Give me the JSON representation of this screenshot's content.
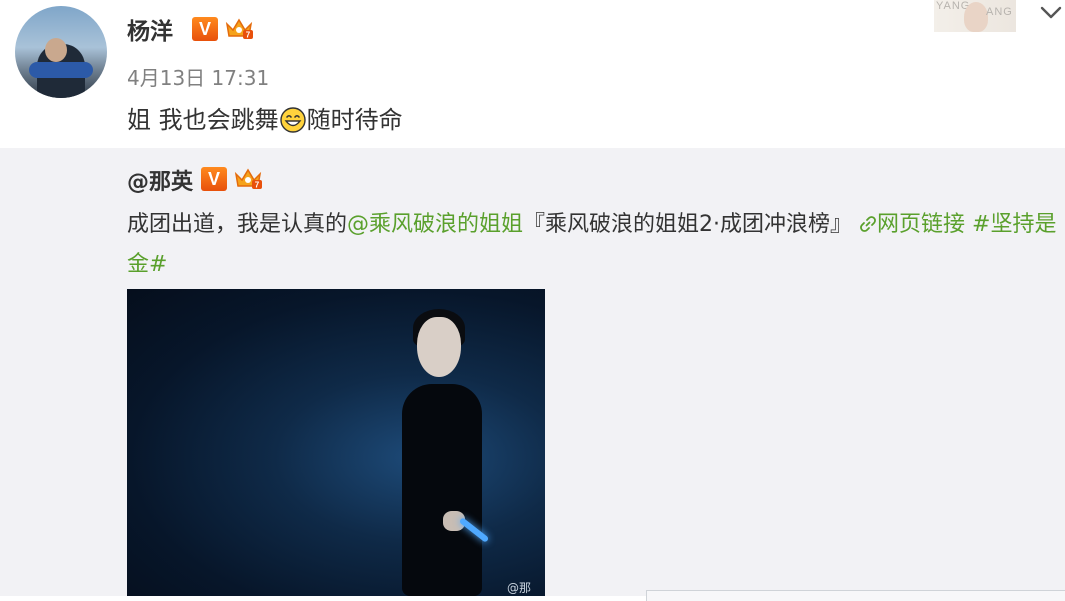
{
  "post": {
    "author": "杨洋",
    "timestamp": "4月13日 17:31",
    "text_before_emoji": "姐 我也会跳舞",
    "emoji_icon": "grinning-face",
    "text_after_emoji": "随时待命",
    "verified_badge": "V"
  },
  "top_thumbnail": {
    "brand_left": "YANG",
    "brand_right": "ANG"
  },
  "repost": {
    "author": "@那英",
    "verified_badge": "V",
    "text_plain_1": "成团出道，我是认真的",
    "mention": "@乘风破浪的姐姐",
    "text_plain_2": "『乘风破浪的姐姐2·成团冲浪榜』",
    "web_link_label": "网页链接",
    "hashtag": "#坚持是金#",
    "photo_watermark": "@那",
    "link_color": "#5aa02c"
  }
}
